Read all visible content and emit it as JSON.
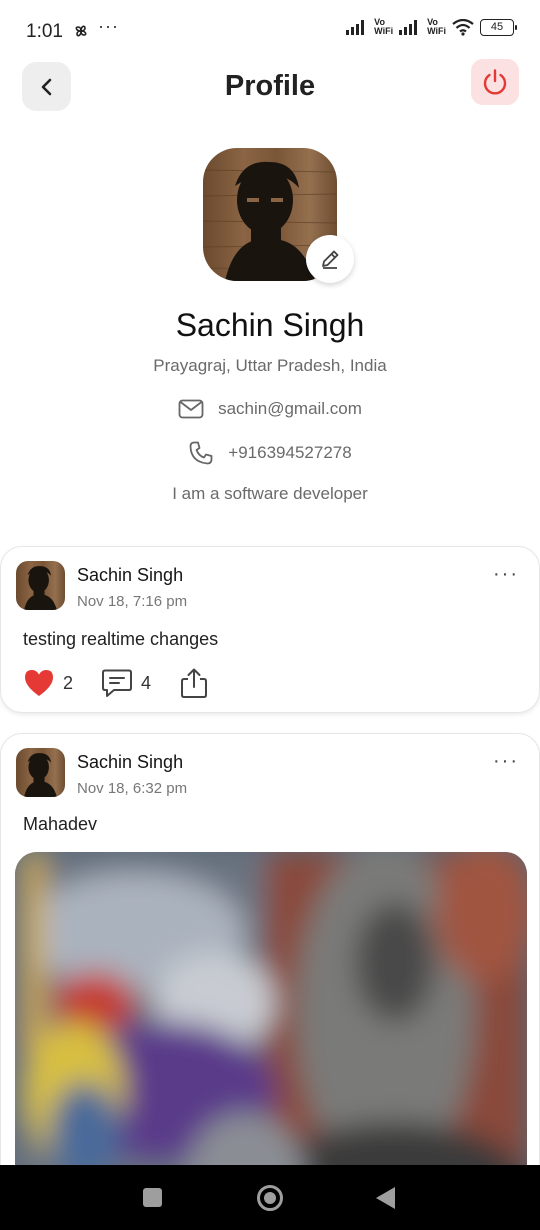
{
  "status_bar": {
    "time": "1:01",
    "dots": "···",
    "vo_label_1": "Vo",
    "wifi_label_1": "WiFi",
    "vo_label_2": "Vo",
    "wifi_label_2": "WiFi",
    "battery": "45"
  },
  "header": {
    "title": "Profile",
    "power_color": "#e53935"
  },
  "profile": {
    "name": "Sachin Singh",
    "location": "Prayagraj, Uttar Pradesh, India",
    "email": "sachin@gmail.com",
    "phone": "+916394527278",
    "bio": "I am a software developer"
  },
  "posts": [
    {
      "author": "Sachin Singh",
      "time": "Nov 18, 7:16 pm",
      "text": "testing realtime changes",
      "likes": "2",
      "comments": "4",
      "more": "···"
    },
    {
      "author": "Sachin Singh",
      "time": "Nov 18, 6:32 pm",
      "text": "Mahadev",
      "more": "···"
    }
  ],
  "colors": {
    "like_heart": "#e53935",
    "back_button_bg": "#eeeeee",
    "power_button_bg": "#fbe1e1"
  }
}
